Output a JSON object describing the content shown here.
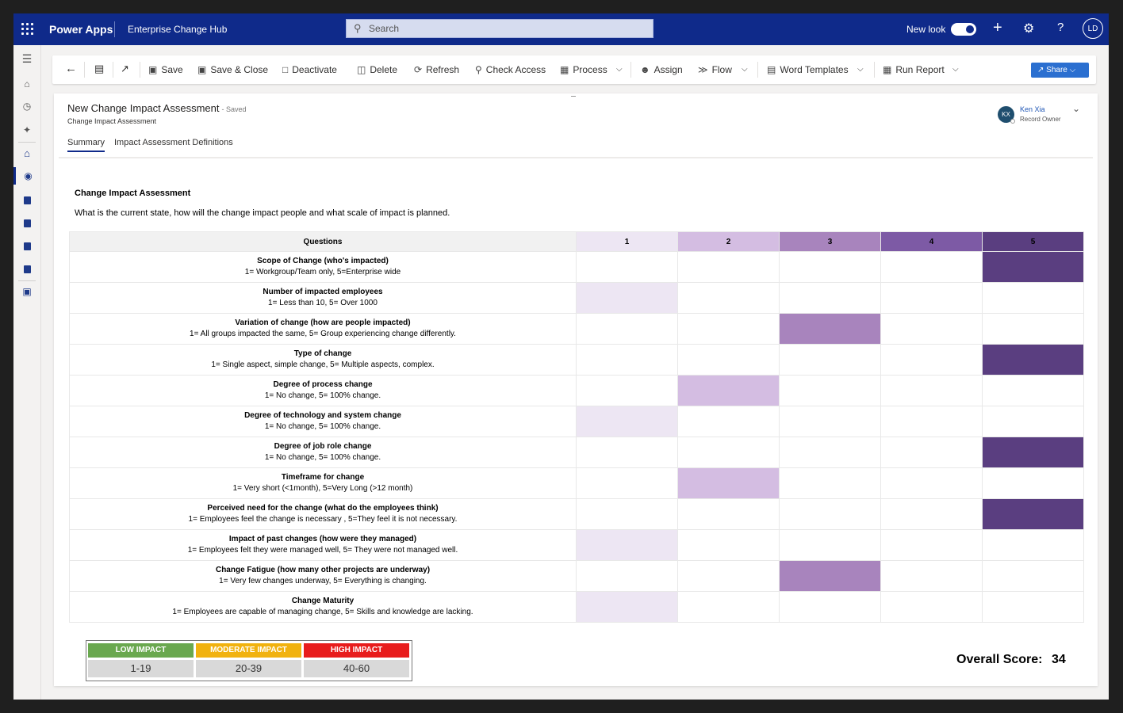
{
  "topbar": {
    "app_name": "Power Apps",
    "environment": "Enterprise Change Hub",
    "search_placeholder": "Search",
    "new_look_label": "New look",
    "new_look_on": true,
    "user_initials": "LD"
  },
  "commands": {
    "save": "Save",
    "save_close": "Save & Close",
    "deactivate": "Deactivate",
    "delete": "Delete",
    "refresh": "Refresh",
    "check_access": "Check Access",
    "process": "Process",
    "assign": "Assign",
    "flow": "Flow",
    "word_templates": "Word Templates",
    "run_report": "Run Report",
    "share": "Share"
  },
  "record": {
    "title": "New Change Impact Assessment",
    "status": "- Saved",
    "entity": "Change Impact Assessment",
    "owner_initials": "KX",
    "owner_name": "Ken Xia",
    "owner_role": "Record Owner"
  },
  "tabs": [
    "Summary",
    "Impact Assessment Definitions"
  ],
  "section": {
    "title": "Change Impact Assessment",
    "description": "What is the current state, how will the change impact people and what scale of impact is planned."
  },
  "grid": {
    "questions_header": "Questions",
    "scale": [
      "1",
      "2",
      "3",
      "4",
      "5"
    ],
    "scale_colors": [
      "#ede6f3",
      "#d4bde2",
      "#a884bd",
      "#7d5aa5",
      "#5a3e80"
    ],
    "rows": [
      {
        "title": "Scope of Change (who's impacted)",
        "scale": "1= Workgroup/Team only, 5=Enterprise wide",
        "selected": 5
      },
      {
        "title": "Number of impacted employees",
        "scale": "1= Less than 10, 5= Over 1000",
        "selected": 1
      },
      {
        "title": "Variation of change (how are people impacted)",
        "scale": "1= All groups impacted the same, 5= Group experiencing change differently.",
        "selected": 3
      },
      {
        "title": "Type of change",
        "scale": "1= Single aspect, simple change, 5= Multiple aspects, complex.",
        "selected": 5
      },
      {
        "title": "Degree of process change",
        "scale": "1= No change, 5= 100% change.",
        "selected": 2
      },
      {
        "title": "Degree of technology and system change",
        "scale": "1= No change, 5= 100% change.",
        "selected": 1
      },
      {
        "title": "Degree of job role change",
        "scale": "1= No change, 5= 100% change.",
        "selected": 5
      },
      {
        "title": "Timeframe for change",
        "scale": "1= Very short (<1month), 5=Very Long (>12 month)",
        "selected": 2
      },
      {
        "title": "Perceived need for the change (what do the employees think)",
        "scale": "1= Employees feel the change is necessary , 5=They feel it is not necessary.",
        "selected": 5
      },
      {
        "title": "Impact of past changes (how were they managed)",
        "scale": "1= Employees felt they were managed well, 5= They were not managed well.",
        "selected": 1
      },
      {
        "title": "Change Fatigue (how many other projects are underway)",
        "scale": "1= Very few changes underway, 5= Everything is changing.",
        "selected": 3
      },
      {
        "title": "Change Maturity",
        "scale": "1= Employees are capable of managing change, 5= Skills and knowledge are lacking.",
        "selected": 1
      }
    ]
  },
  "legend": [
    {
      "label": "LOW IMPACT",
      "range": "1-19",
      "color": "#6aa84f"
    },
    {
      "label": "MODERATE IMPACT",
      "range": "20-39",
      "color": "#f1b20f"
    },
    {
      "label": "HIGH IMPACT",
      "range": "40-60",
      "color": "#e81c1c"
    }
  ],
  "score": {
    "label": "Overall Score:",
    "value": "34"
  }
}
